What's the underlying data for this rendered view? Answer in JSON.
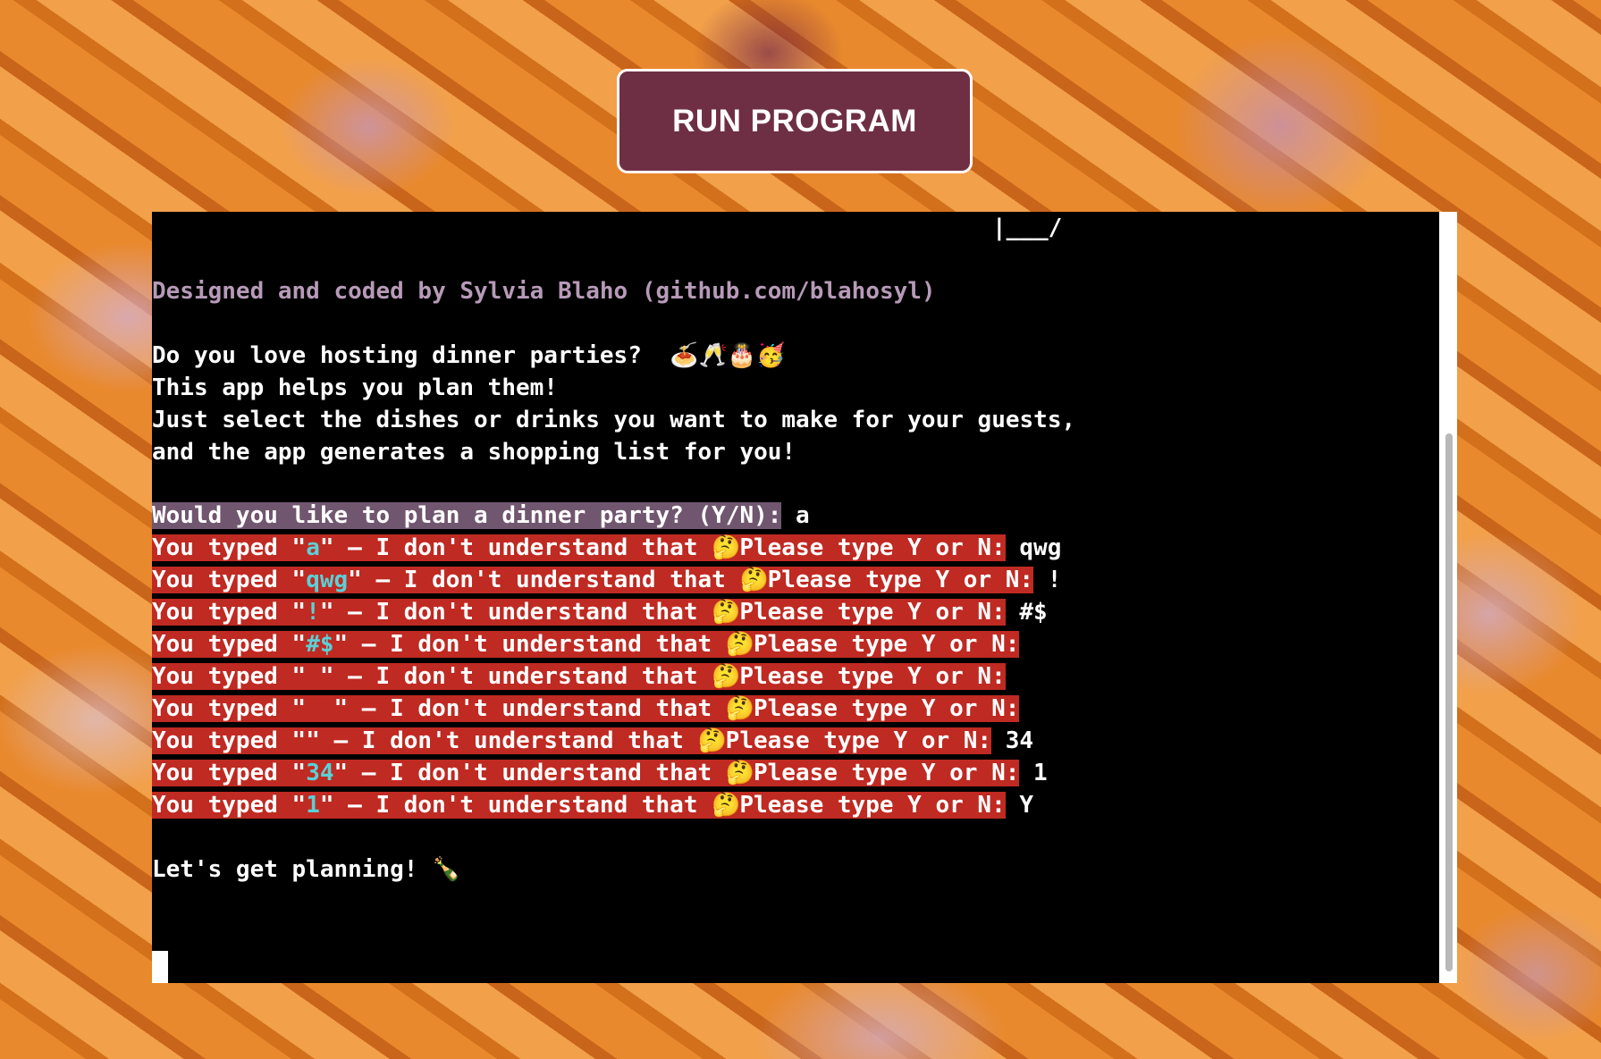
{
  "run_button": {
    "label": "RUN PROGRAM"
  },
  "terminal": {
    "ascii_tail": "|___/",
    "credit": "Designed and coded by Sylvia Blaho (github.com/blahosyl)",
    "intro": [
      {
        "text": "Do you love hosting dinner parties?  ",
        "emoji": "🍝🥂🎂🥳"
      },
      {
        "text": "This app helps you plan them!"
      },
      {
        "text": "Just select the dishes or drinks you want to make for your guests,"
      },
      {
        "text": "and the app generates a shopping list for you!"
      }
    ],
    "prompt": {
      "question": "Would you like to plan a dinner party? (Y/N):",
      "answer": " a"
    },
    "error_lines": [
      {
        "prefix": "You typed \"",
        "input": "a",
        "suffix": "\" — I don't understand that ",
        "emoji": "🤔",
        "ask": "Please type Y or N:",
        "answer": " qwg"
      },
      {
        "prefix": "You typed \"",
        "input": "qwg",
        "suffix": "\" — I don't understand that ",
        "emoji": "🤔",
        "ask": "Please type Y or N:",
        "answer": " !"
      },
      {
        "prefix": "You typed \"",
        "input": "!",
        "suffix": "\" — I don't understand that ",
        "emoji": "🤔",
        "ask": "Please type Y or N:",
        "answer": " #$"
      },
      {
        "prefix": "You typed \"",
        "input": "#$",
        "suffix": "\" — I don't understand that ",
        "emoji": "🤔",
        "ask": "Please type Y or N:",
        "answer": ""
      },
      {
        "prefix": "You typed \"",
        "input": " ",
        "suffix": "\" — I don't understand that ",
        "emoji": "🤔",
        "ask": "Please type Y or N:",
        "answer": ""
      },
      {
        "prefix": "You typed \"",
        "input": "  ",
        "suffix": "\" — I don't understand that ",
        "emoji": "🤔",
        "ask": "Please type Y or N:",
        "answer": ""
      },
      {
        "prefix": "You typed \"",
        "input": "",
        "suffix": "\" — I don't understand that ",
        "emoji": "🤔",
        "ask": "Please type Y or N:",
        "answer": " 34"
      },
      {
        "prefix": "You typed \"",
        "input": "34",
        "suffix": "\" — I don't understand that ",
        "emoji": "🤔",
        "ask": "Please type Y or N:",
        "answer": " 1"
      },
      {
        "prefix": "You typed \"",
        "input": "1",
        "suffix": "\" — I don't understand that ",
        "emoji": "🤔",
        "ask": "Please type Y or N:",
        "answer": " Y"
      }
    ],
    "closing": {
      "text": "Let's get planning! ",
      "emoji": "🍾"
    }
  },
  "colors": {
    "button_bg": "#6e2f44",
    "credit_text": "#b79ab8",
    "prompt_highlight": "#70566f",
    "error_highlight": "#bf2a22",
    "input_echo": "#5bd0d6"
  },
  "icons": [
    "spaghetti-icon",
    "clinking-glasses-icon",
    "birthday-cake-icon",
    "partying-face-icon",
    "thinking-face-icon",
    "champagne-bottle-icon"
  ]
}
